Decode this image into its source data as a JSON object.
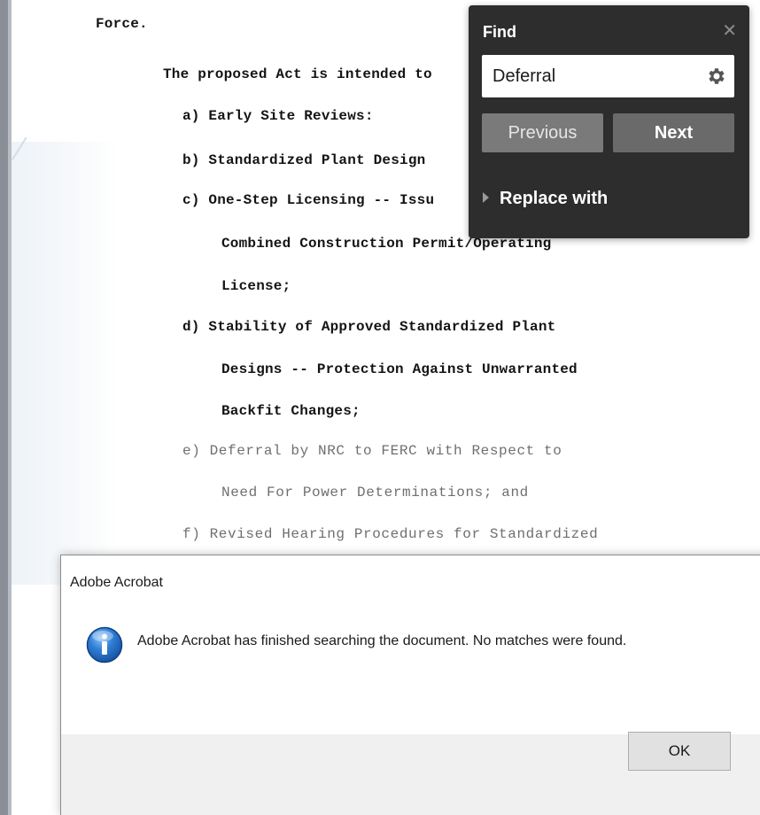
{
  "document": {
    "lines": [
      {
        "text": "Force.",
        "faded": false
      },
      {
        "text": "The proposed Act is intended to",
        "faded": false
      },
      {
        "text": "a)  Early Site Reviews:",
        "faded": false
      },
      {
        "text": "b)  Standardized Plant Design",
        "faded": false
      },
      {
        "text": "c)  One-Step Licensing -- Issu",
        "faded": false
      },
      {
        "text": "Combined Construction Permit/Operating",
        "faded": false
      },
      {
        "text": "License;",
        "faded": false
      },
      {
        "text": "d)  Stability of Approved Standardized Plant",
        "faded": false
      },
      {
        "text": "Designs -- Protection Against Unwarranted",
        "faded": false
      },
      {
        "text": "Backfit Changes;",
        "faded": false
      },
      {
        "text": "e)  Deferral by NRC to FERC with Respect to",
        "faded": true
      },
      {
        "text": "Need For Power Determinations; and",
        "faded": true
      },
      {
        "text": "f)  Revised Hearing Procedures for Standardized",
        "faded": true
      }
    ]
  },
  "find_panel": {
    "title": "Find",
    "close_icon": "close-icon",
    "search_value": "Deferral",
    "settings_icon": "gear-icon",
    "previous_label": "Previous",
    "next_label": "Next",
    "replace_label": "Replace with"
  },
  "dialog": {
    "title": "Adobe Acrobat",
    "icon": "info-icon",
    "message": "Adobe Acrobat has finished searching the document. No matches were found.",
    "ok_label": "OK"
  },
  "colors": {
    "find_panel_bg": "#2d2d2d",
    "info_icon_blue": "#1f6fc5"
  }
}
